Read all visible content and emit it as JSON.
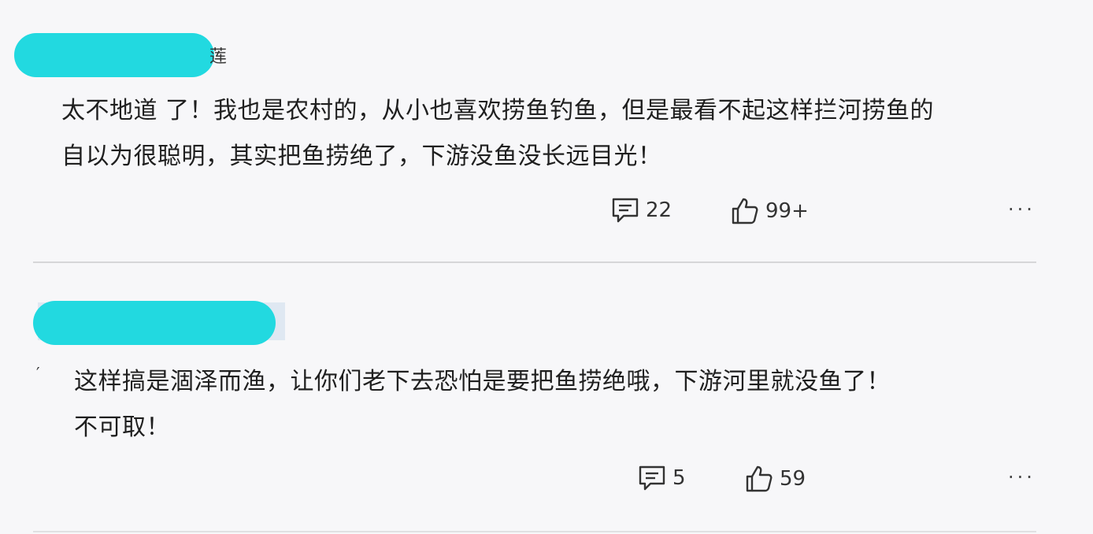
{
  "comments": [
    {
      "username_visible": "莲",
      "text_line1": "太不地道 了！我也是农村的，从小也喜欢捞鱼钓鱼，但是最看不起这样拦河捞鱼的",
      "text_line2": "自以为很聪明，其实把鱼捞绝了，下游没鱼没长远目光！",
      "reply_count": "22",
      "like_count": "99+",
      "more_label": "···",
      "reply_icon": "comment-icon",
      "like_icon": "thumbs-up-icon"
    },
    {
      "username_visible": "",
      "mark": "′",
      "text_line1": "这样搞是涸泽而渔，让你们老下去恐怕是要把鱼捞绝哦，下游河里就没鱼了！",
      "text_line2": "不可取！",
      "reply_count": "5",
      "like_count": "59",
      "more_label": "···",
      "reply_icon": "comment-icon",
      "like_icon": "thumbs-up-icon"
    }
  ],
  "colors": {
    "background": "#f7f7f9",
    "redaction": "#22d9e0",
    "divider": "#d6d6d8",
    "text": "#1f1f1f"
  }
}
